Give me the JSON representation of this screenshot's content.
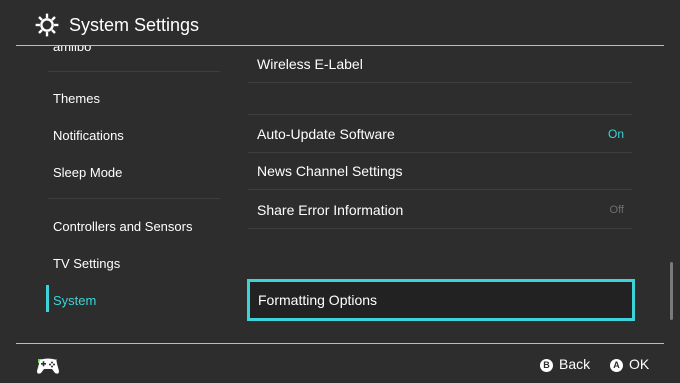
{
  "header": {
    "title": "System Settings",
    "icon": "gear-icon"
  },
  "sidebar": {
    "items": [
      {
        "label": "amiibo"
      },
      {
        "label": "Themes"
      },
      {
        "label": "Notifications"
      },
      {
        "label": "Sleep Mode"
      },
      {
        "label": "Controllers and Sensors"
      },
      {
        "label": "TV Settings"
      },
      {
        "label": "System",
        "selected": true
      }
    ]
  },
  "main": {
    "rows": [
      {
        "label": "Wireless E-Label"
      },
      {
        "label": "Auto-Update Software",
        "value": "On"
      },
      {
        "label": "News Channel Settings"
      },
      {
        "label": "Share Error Information",
        "value": "Off"
      },
      {
        "label": "Formatting Options",
        "focused": true
      }
    ]
  },
  "footer": {
    "back_key": "B",
    "back_label": "Back",
    "ok_key": "A",
    "ok_label": "OK",
    "controller_icon": "controller-icon"
  },
  "colors": {
    "accent": "#3ed3d7",
    "background": "#2d2d2d",
    "indicator": "#6ae04a"
  }
}
